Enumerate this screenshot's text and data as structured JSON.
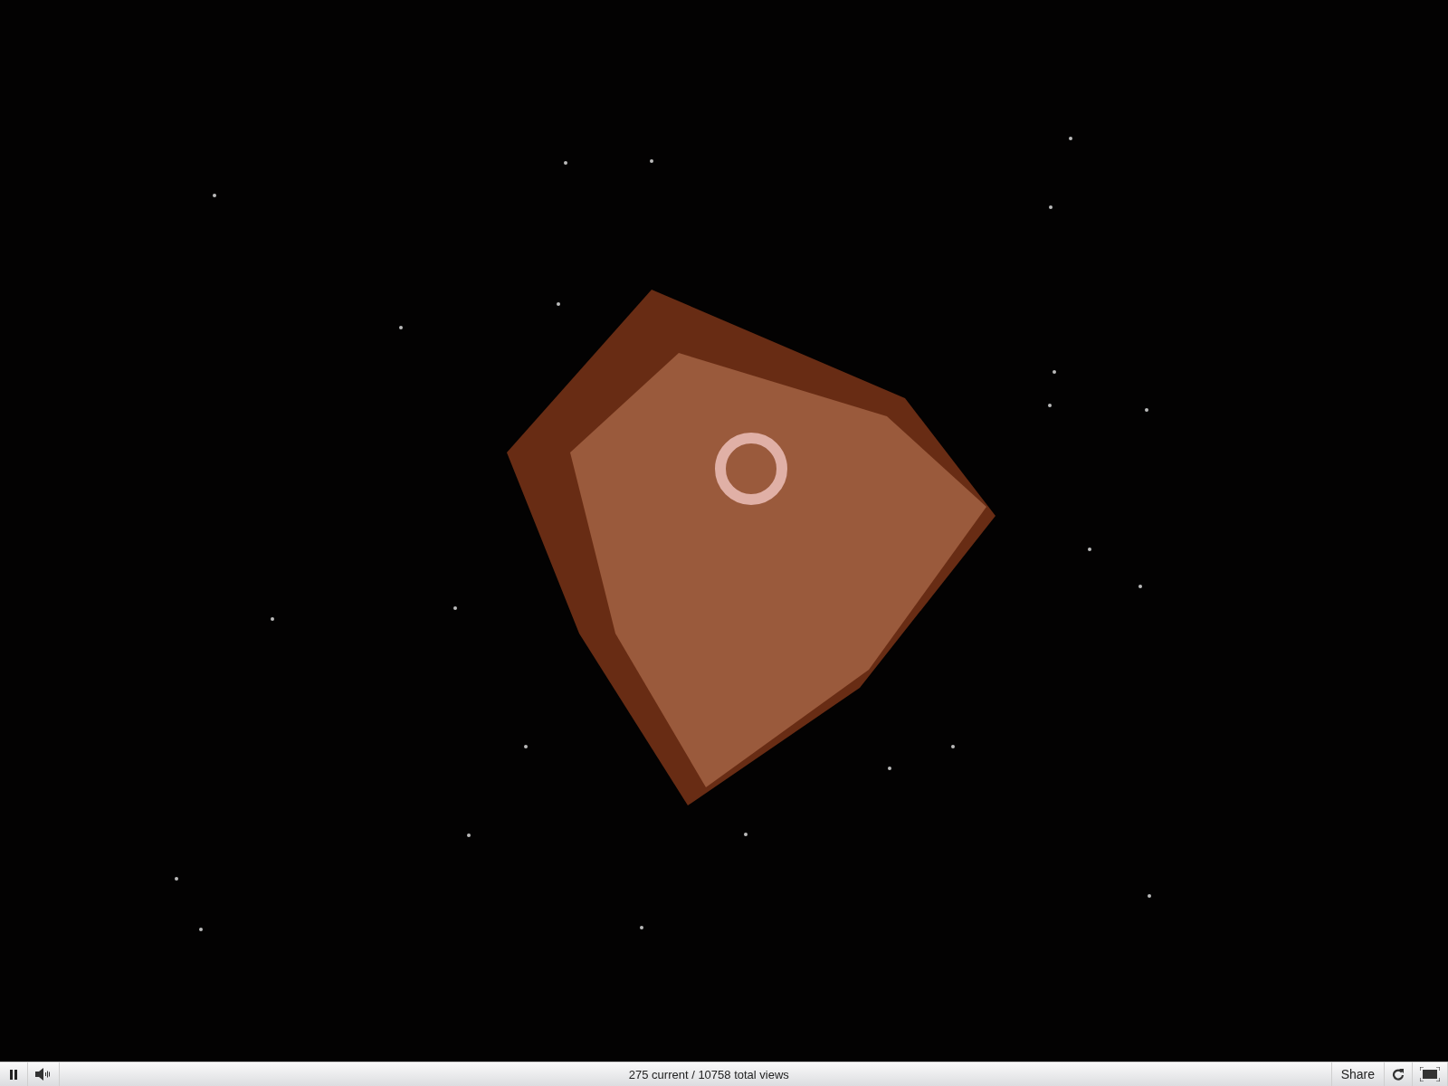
{
  "player": {
    "view_count": "275 current / 10758 total views",
    "share_label": "Share"
  }
}
